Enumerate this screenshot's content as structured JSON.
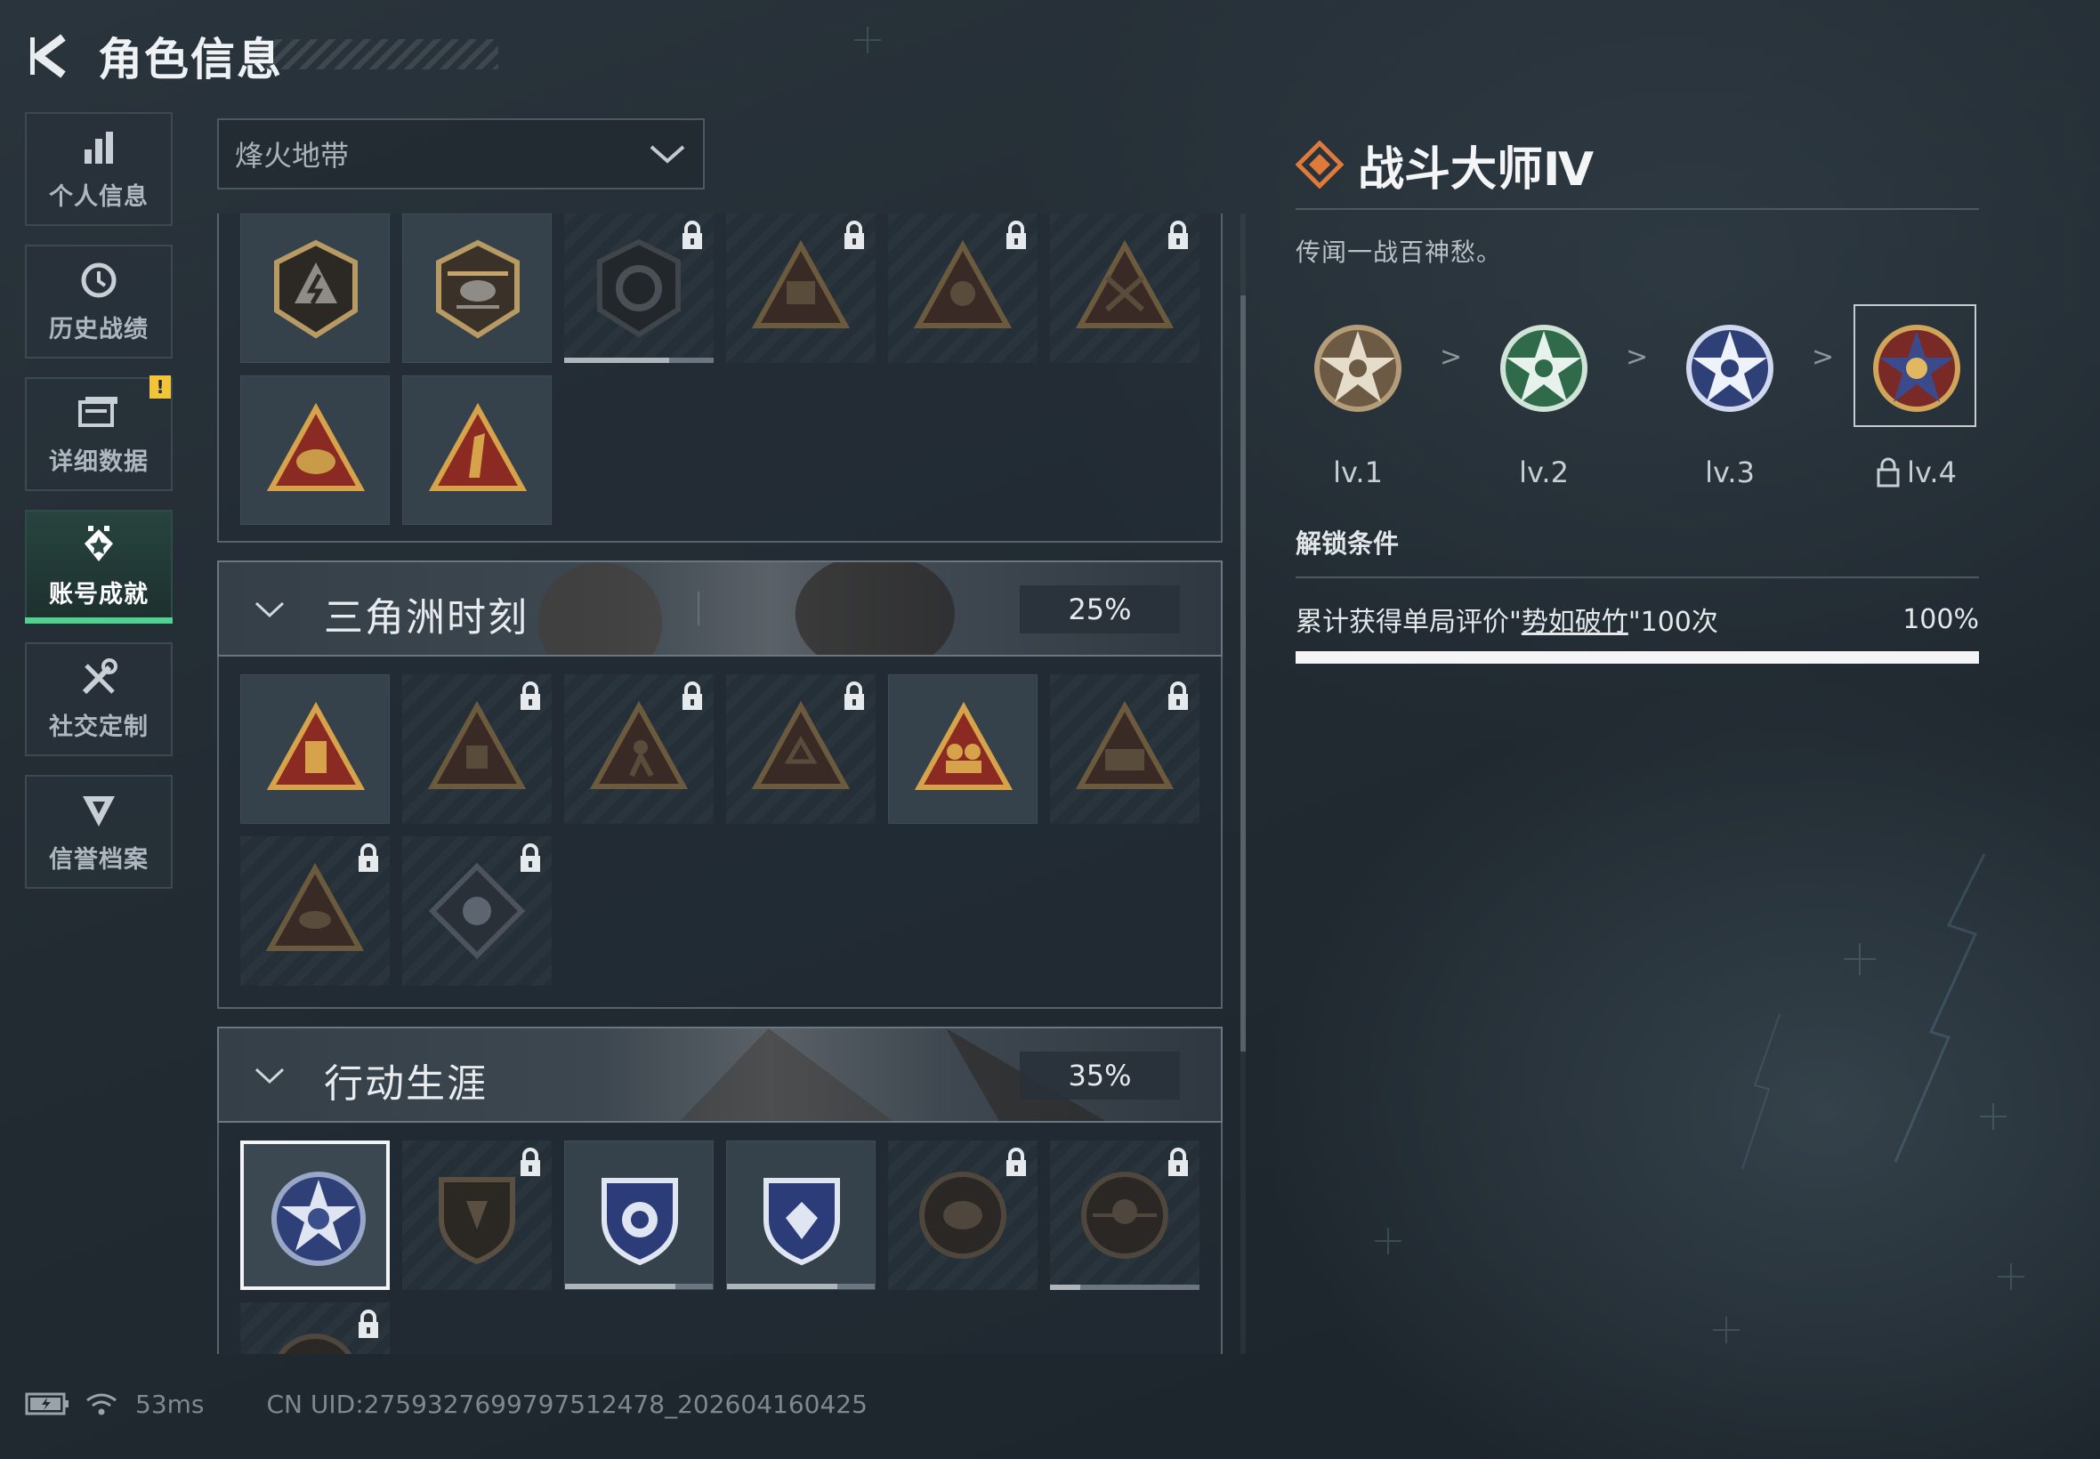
{
  "header": {
    "title": "角色信息",
    "back_icon": "back-arrow-icon"
  },
  "sidebar": {
    "items": [
      {
        "label": "个人信息",
        "icon": "bar-chart-icon",
        "active": false
      },
      {
        "label": "历史战绩",
        "icon": "history-clock-icon",
        "active": false
      },
      {
        "label": "详细数据",
        "icon": "data-folder-icon",
        "active": false,
        "badge": "!"
      },
      {
        "label": "账号成就",
        "icon": "achievement-icon",
        "active": true
      },
      {
        "label": "社交定制",
        "icon": "tools-icon",
        "active": false
      },
      {
        "label": "信誉档案",
        "icon": "credit-shield-icon",
        "active": false
      }
    ]
  },
  "mode_select": {
    "value": "烽火地带"
  },
  "groups": [
    {
      "name": "三角洲时刻",
      "progress": "25%"
    },
    {
      "name": "行动生涯",
      "progress": "35%"
    }
  ],
  "detail": {
    "title": "战斗大师Ⅳ",
    "description": "传闻一战百神愁。",
    "levels": [
      {
        "label": "lv.1",
        "locked": false
      },
      {
        "label": "lv.2",
        "locked": false
      },
      {
        "label": "lv.3",
        "locked": false
      },
      {
        "label": "lv.4",
        "locked": true
      }
    ],
    "separator": ">",
    "unlock_title": "解锁条件",
    "condition": {
      "prefix": "累计获得单局评价\"",
      "highlight": "势如破竹",
      "suffix": "\"100次",
      "percent": "100%",
      "fill": 1.0
    }
  },
  "status_bar": {
    "ping": "53ms",
    "uid": "CN UID:275932769979​7512478_202604160425"
  },
  "colors": {
    "accent_green": "#4fd28f",
    "badge_yellow": "#f2c43a",
    "title_diamond": "#e07a3a"
  }
}
